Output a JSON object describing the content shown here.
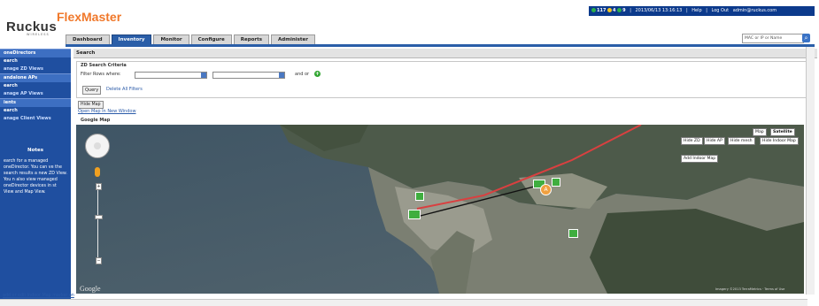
{
  "header": {
    "logo": "Ruckus",
    "logo_sub": "WIRELESS",
    "app_title": "FlexMaster",
    "status_count1": "117",
    "status_count2": "4",
    "status_count3": "9",
    "datetime": "2013/06/13 13:16:13",
    "help": "Help",
    "logout": "Log Out",
    "user": "admin@ruckus.com",
    "search_placeholder": "MAC or IP or Name",
    "colors": {
      "brand_orange": "#f0782a",
      "topbar": "#0c3a8c",
      "tab_active": "#2a5ea8"
    }
  },
  "tabs": [
    {
      "label": "Dashboard",
      "active": false
    },
    {
      "label": "Inventory",
      "active": true
    },
    {
      "label": "Monitor",
      "active": false
    },
    {
      "label": "Configure",
      "active": false
    },
    {
      "label": "Reports",
      "active": false
    },
    {
      "label": "Administer",
      "active": false
    }
  ],
  "sidebar": {
    "items": [
      {
        "label": "oneDirectors",
        "type": "head"
      },
      {
        "label": "earch",
        "type": "item"
      },
      {
        "label": "anage ZD Views",
        "type": "item"
      },
      {
        "label": "andalone APs",
        "type": "head"
      },
      {
        "label": "earch",
        "type": "item"
      },
      {
        "label": "anage AP Views",
        "type": "item"
      },
      {
        "label": "ients",
        "type": "head"
      },
      {
        "label": "earch",
        "type": "item"
      },
      {
        "label": "anage Client Views",
        "type": "item"
      }
    ],
    "notes_title": "Notes",
    "notes_text": "earch for a managed oneDirector. You can ve the search results a new ZD View. You n also view managed oneDirector devices in st View and Map View."
  },
  "main": {
    "section_title": "Search",
    "criteria_title": "ZD Search Criteria",
    "filter_label": "Filter Rows where:",
    "and_or": "and  or",
    "query_button": "Query",
    "delete_filters": "Delete All Filters",
    "hide_map": "Hide Map",
    "open_map": "Open Map In New Window",
    "map_label": "Google Map"
  },
  "map": {
    "type_buttons": [
      "Map",
      "Satellite"
    ],
    "toggle_buttons": [
      "Hide ZD",
      "Hide AP",
      "Hide mesh",
      "Hide Indoor Map"
    ],
    "add_indoor": "Add Indoor Map",
    "marker_label": "A",
    "google_logo": "Google",
    "attribution": "Imagery ©2013 TerraMetrics · Terms of Use"
  },
  "footer": {
    "link": "add or edit Indoor Map marker on"
  }
}
